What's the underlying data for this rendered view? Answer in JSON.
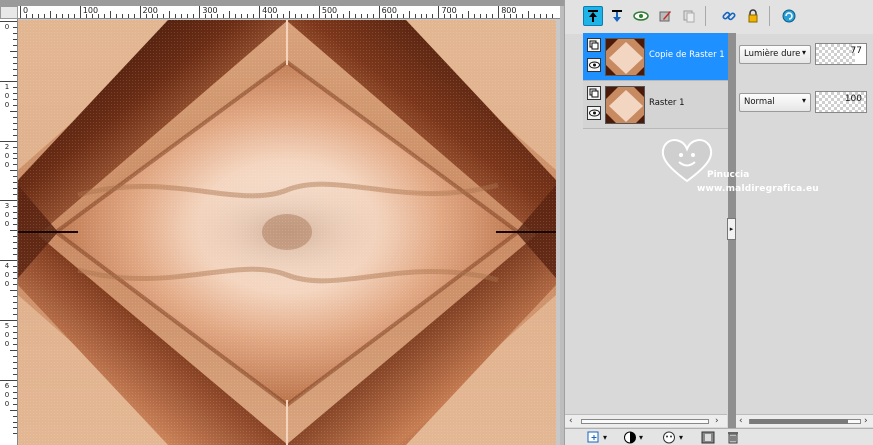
{
  "ruler": {
    "top_labels": [
      "0",
      "100",
      "200",
      "300",
      "400",
      "500",
      "600",
      "700",
      "800"
    ],
    "left_labels": [
      "0",
      "1\n0\n0",
      "2\n0\n0",
      "3\n0\n0",
      "4\n0\n0",
      "5\n0\n0",
      "6\n0\n0"
    ]
  },
  "toolbar": {
    "icons": [
      "move-layer-up-icon",
      "move-layer-down-icon",
      "visibility-eye-icon",
      "edit-layer-icon",
      "duplicate-layer-icon",
      "link-icon",
      "lock-icon",
      "refresh-icon"
    ]
  },
  "layers": [
    {
      "name": "Copie de Raster 1",
      "blend_mode": "Lumière dure",
      "opacity": "77",
      "opacity_level": 0.77,
      "selected": true
    },
    {
      "name": "Raster 1",
      "blend_mode": "Normal",
      "opacity": "100",
      "opacity_level": 1.0,
      "selected": false
    }
  ],
  "watermark": {
    "line1": "Pinuccia",
    "line2": "www.maldiregrafica.eu"
  },
  "colors": {
    "selection": "#1e90ff",
    "active_tool": "#1fb4e8",
    "image_dark": "#3a1408",
    "image_mid": "#9c5a34",
    "image_light": "#f7e4d6"
  }
}
